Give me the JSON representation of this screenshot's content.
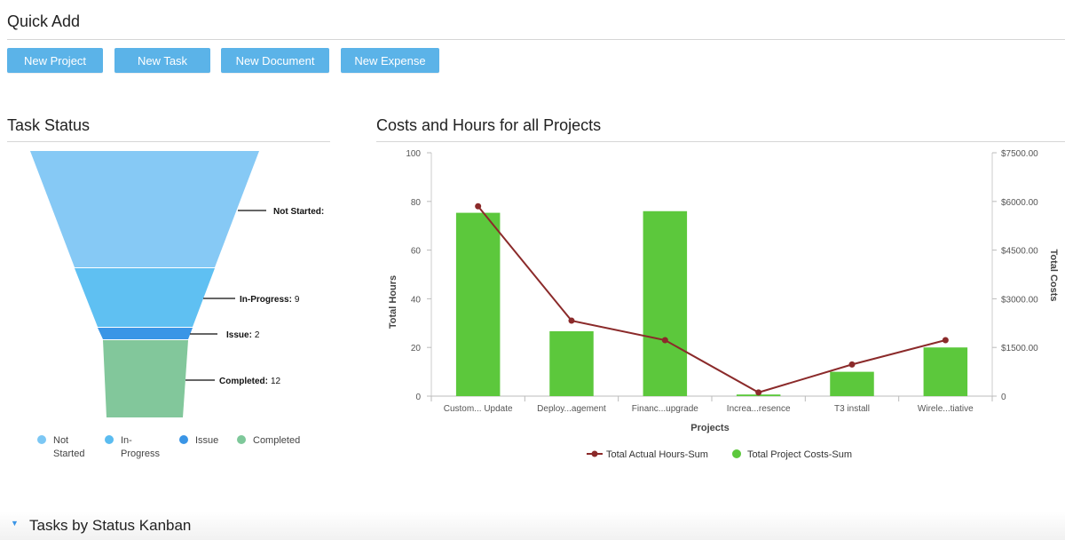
{
  "quick_add": {
    "title": "Quick Add",
    "buttons": [
      "New Project",
      "New Task",
      "New Document",
      "New Expense"
    ]
  },
  "task_status": {
    "title": "Task Status",
    "funnel_labels": [
      {
        "name": "Not Started:",
        "value": ""
      },
      {
        "name": "In-Progress:",
        "value": "9"
      },
      {
        "name": "Issue:",
        "value": "2"
      },
      {
        "name": "Completed:",
        "value": "12"
      }
    ],
    "legend": [
      {
        "label1": "Not",
        "label2": "Started",
        "color": "#7cc7f4"
      },
      {
        "label1": "In-",
        "label2": "Progress",
        "color": "#5bbcf0"
      },
      {
        "label1": "Issue",
        "label2": "",
        "color": "#3a95e6"
      },
      {
        "label1": "Completed",
        "label2": "",
        "color": "#7ec89a"
      }
    ],
    "colors": [
      "#86c9f5",
      "#5fc0f2",
      "#3a95e6",
      "#82c79b"
    ]
  },
  "costs_chart": {
    "title": "Costs and Hours for all Projects"
  },
  "chart_data": {
    "type": "bar",
    "categories": [
      "Custom... Update",
      "Deploy...agement",
      "Financ...upgrade",
      "Increa...resence",
      "T3 install",
      "Wirele...tiative"
    ],
    "xlabel": "Projects",
    "ylabel": "Total Hours",
    "y2label": "Total Costs",
    "ylim": [
      0,
      100
    ],
    "y2lim": [
      0,
      7500
    ],
    "yticks": [
      "0",
      "20",
      "40",
      "60",
      "80",
      "100"
    ],
    "y2ticks": [
      "0",
      "$1500.00",
      "$3000.00",
      "$4500.00",
      "$6000.00",
      "$7500.00"
    ],
    "series": [
      {
        "name": "Total Actual Hours-Sum",
        "kind": "line",
        "color": "#8b2a2a",
        "values": [
          78,
          31,
          23,
          1.5,
          13,
          23
        ]
      },
      {
        "name": "Total Project Costs-Sum",
        "kind": "bar",
        "color": "#5cc83c",
        "values": [
          5650,
          2000,
          5700,
          50,
          750,
          1500
        ]
      }
    ],
    "legend_position": "bottom",
    "grid": false
  },
  "kanban": {
    "title": "Tasks by Status Kanban",
    "arrow": "▼"
  }
}
